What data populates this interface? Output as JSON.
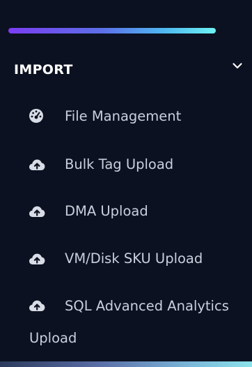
{
  "section": {
    "title": "IMPORT",
    "expanded": true,
    "chevron_icon": "chevron-down-icon"
  },
  "menu": {
    "items": [
      {
        "label": "File Management",
        "icon": "dashboard-gauge-icon"
      },
      {
        "label": "Bulk Tag Upload",
        "icon": "cloud-upload-icon"
      },
      {
        "label": "DMA Upload",
        "icon": "cloud-upload-icon"
      },
      {
        "label": "VM/Disk SKU Upload",
        "icon": "cloud-upload-icon"
      },
      {
        "label": "SQL Advanced Analytics Upload",
        "icon": "cloud-upload-icon"
      }
    ]
  },
  "colors": {
    "background": "#0b1120",
    "header_text": "#ffffff",
    "item_text": "#c9cfdc",
    "icon": "#d8dce6",
    "accent_gradient_start": "#7b3df2",
    "accent_gradient_end": "#6ef2f2"
  }
}
